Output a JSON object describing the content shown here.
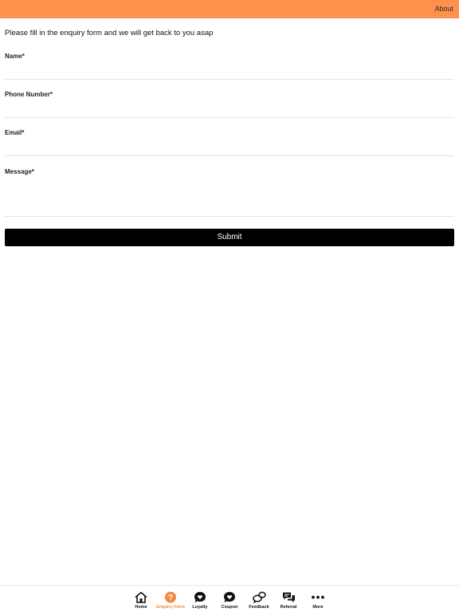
{
  "header": {
    "about_label": "About",
    "bar_color": "#ff914d"
  },
  "form": {
    "intro": "Please fill in the enquiry form and we will get back to you asap",
    "fields": [
      {
        "label": "Name*",
        "value": ""
      },
      {
        "label": "Phone Number*",
        "value": ""
      },
      {
        "label": "Email*",
        "value": ""
      },
      {
        "label": "Message*",
        "value": ""
      }
    ],
    "submit_label": "Submit"
  },
  "tabbar": {
    "active_color": "#f08a3c",
    "items": [
      {
        "label": "Home",
        "icon": "home-icon"
      },
      {
        "label": "Enquiry Form",
        "icon": "question-icon",
        "active": true
      },
      {
        "label": "Loyalty",
        "icon": "heart-bubble-icon"
      },
      {
        "label": "Coupon",
        "icon": "coupon-bubble-icon"
      },
      {
        "label": "Feedback",
        "icon": "feedback-icon"
      },
      {
        "label": "Referral",
        "icon": "referral-icon"
      },
      {
        "label": "More",
        "icon": "more-dots-icon"
      }
    ]
  }
}
